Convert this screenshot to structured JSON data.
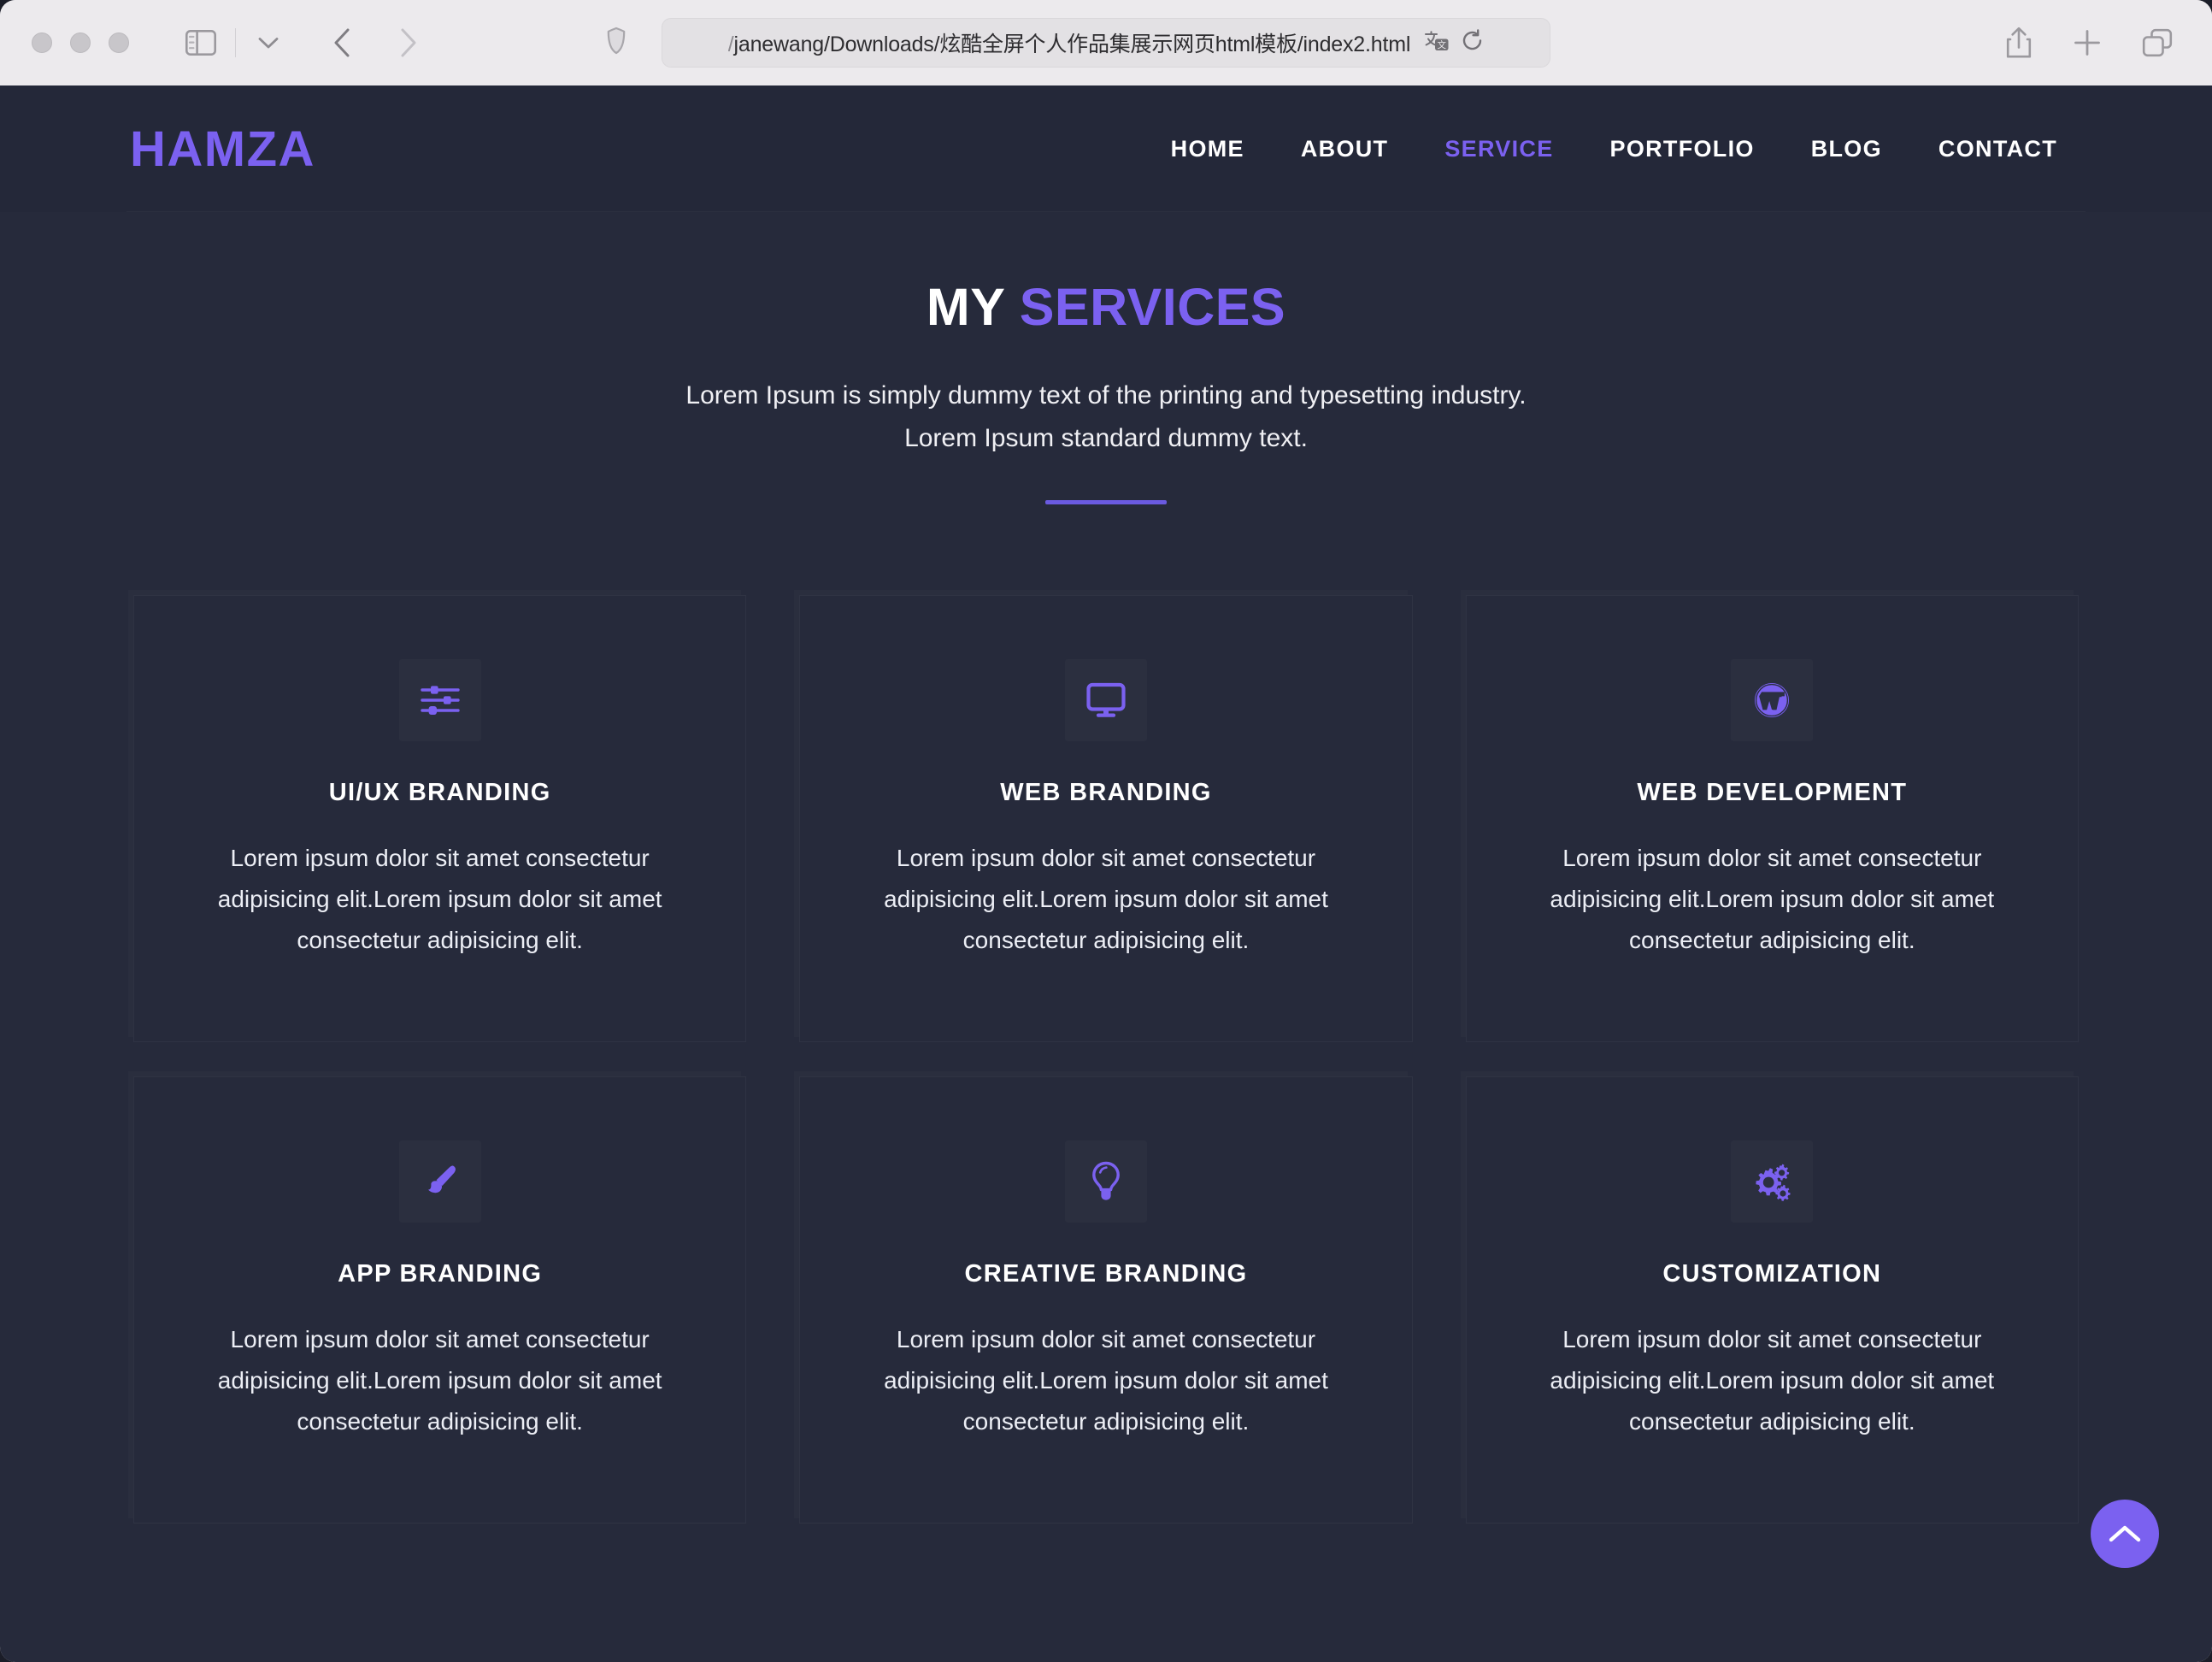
{
  "browser": {
    "traffic_lights": [
      "close",
      "minimize",
      "zoom"
    ],
    "sidebar_label": "sidebar-toggle",
    "url_prefix": "/",
    "url_value": "janewang/Downloads/炫酷全屏个人作品集展示网页html模板/index2.html",
    "translate_label": "translate",
    "reload_label": "reload",
    "share_label": "share",
    "new_tab_label": "new-tab",
    "tab_overview_label": "tab-overview"
  },
  "site": {
    "logo": "HAMZA",
    "nav": [
      {
        "label": "HOME",
        "active": false
      },
      {
        "label": "ABOUT",
        "active": false
      },
      {
        "label": "SERVICE",
        "active": true
      },
      {
        "label": "PORTFOLIO",
        "active": false
      },
      {
        "label": "BLOG",
        "active": false
      },
      {
        "label": "CONTACT",
        "active": false
      }
    ]
  },
  "section": {
    "title_plain": "MY",
    "title_accent": "SERVICES",
    "subtitle": "Lorem Ipsum is simply dummy text of the printing and typesetting industry. Lorem Ipsum standard dummy text."
  },
  "cards": [
    {
      "icon": "sliders-icon",
      "title": "UI/UX BRANDING",
      "desc": "Lorem ipsum dolor sit amet consectetur adipisicing elit.Lorem ipsum dolor sit amet consectetur adipisicing elit."
    },
    {
      "icon": "desktop-monitor-icon",
      "title": "WEB BRANDING",
      "desc": "Lorem ipsum dolor sit amet consectetur adipisicing elit.Lorem ipsum dolor sit amet consectetur adipisicing elit."
    },
    {
      "icon": "wordpress-icon",
      "title": "WEB DEVELOPMENT",
      "desc": "Lorem ipsum dolor sit amet consectetur adipisicing elit.Lorem ipsum dolor sit amet consectetur adipisicing elit."
    },
    {
      "icon": "paint-brush-icon",
      "title": "APP BRANDING",
      "desc": "Lorem ipsum dolor sit amet consectetur adipisicing elit.Lorem ipsum dolor sit amet consectetur adipisicing elit."
    },
    {
      "icon": "light-bulb-icon",
      "title": "CREATIVE BRANDING",
      "desc": "Lorem ipsum dolor sit amet consectetur adipisicing elit.Lorem ipsum dolor sit amet consectetur adipisicing elit."
    },
    {
      "icon": "gears-icon",
      "title": "CUSTOMIZATION",
      "desc": "Lorem ipsum dolor sit amet consectetur adipisicing elit.Lorem ipsum dolor sit amet consectetur adipisicing elit."
    }
  ],
  "scroll_top": {
    "label": "scroll-to-top"
  },
  "colors": {
    "accent": "#7b61f0",
    "page_bg": "#262a3b",
    "header_bg": "#242839",
    "divider": "#6a5ae0",
    "text": "#ffffff",
    "chrome_bg": "#eceaed"
  }
}
